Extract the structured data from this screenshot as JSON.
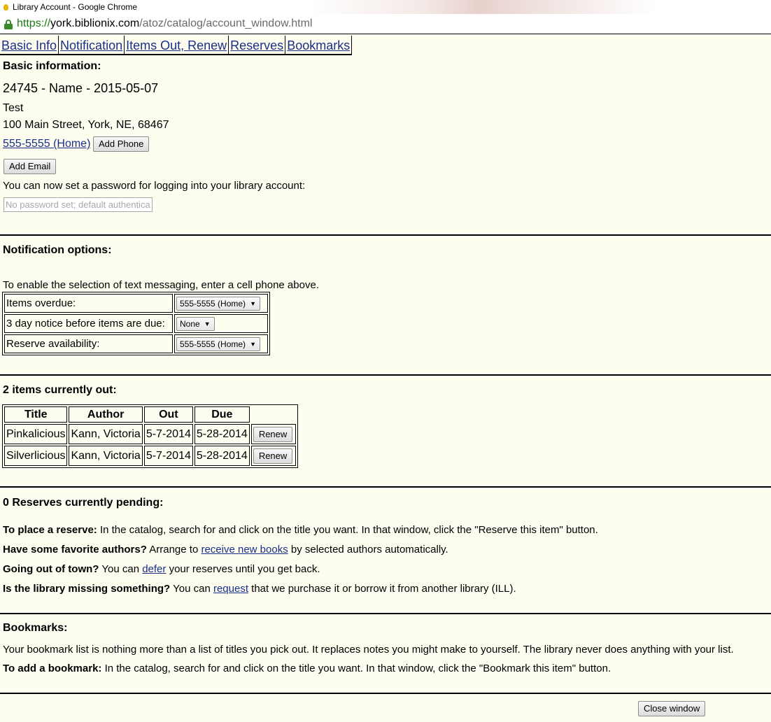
{
  "window": {
    "title": "Library Account - Google Chrome"
  },
  "address_bar": {
    "scheme": "https://",
    "host": "york.biblionix.com",
    "path": "/atoz/catalog/account_window.html"
  },
  "tabs": [
    {
      "label": "Basic Info"
    },
    {
      "label": "Notification"
    },
    {
      "label": "Items Out, Renew"
    },
    {
      "label": "Reserves"
    },
    {
      "label": "Bookmarks"
    }
  ],
  "basic": {
    "heading": "Basic information:",
    "account_line": "24745 - Name - 2015-05-07",
    "name": "Test",
    "address": "100 Main Street, York, NE, 68467",
    "phone_link": "555-5555 (Home)",
    "add_phone_label": "Add Phone",
    "add_email_label": "Add Email",
    "password_prompt": "You can now set a password for logging into your library account:",
    "password_placeholder": "No password set; default authentication"
  },
  "notification": {
    "heading": "Notification options:",
    "hint": "To enable the selection of text messaging, enter a cell phone above.",
    "rows": [
      {
        "label": "Items overdue:",
        "value": "555-5555 (Home)"
      },
      {
        "label": "3 day notice before items are due:",
        "value": "None"
      },
      {
        "label": "Reserve availability:",
        "value": "555-5555 (Home)"
      }
    ]
  },
  "items_out": {
    "heading": "2 items currently out:",
    "columns": [
      "Title",
      "Author",
      "Out",
      "Due"
    ],
    "rows": [
      {
        "title": "Pinkalicious",
        "author": "Kann, Victoria",
        "out": "5-7-2014",
        "due": "5-28-2014",
        "action": "Renew"
      },
      {
        "title": "Silverlicious",
        "author": "Kann, Victoria",
        "out": "5-7-2014",
        "due": "5-28-2014",
        "action": "Renew"
      }
    ]
  },
  "reserves": {
    "heading": "0 Reserves currently pending:",
    "place_bold": "To place a reserve:",
    "place_text": " In the catalog, search for and click on the title you want. In that window, click the \"Reserve this item\" button.",
    "authors_bold": "Have some favorite authors?",
    "authors_pre": " Arrange to ",
    "authors_link": "receive new books",
    "authors_post": " by selected authors automatically.",
    "town_bold": "Going out of town?",
    "town_pre": " You can ",
    "town_link": "defer",
    "town_post": " your reserves until you get back.",
    "missing_bold": "Is the library missing something?",
    "missing_pre": " You can ",
    "missing_link": "request",
    "missing_post": " that we purchase it or borrow it from another library (ILL)."
  },
  "bookmarks": {
    "heading": "Bookmarks:",
    "description": "Your bookmark list is nothing more than a list of titles you pick out. It replaces notes you might make to yourself. The library never does anything with your list.",
    "add_bold": "To add a bookmark:",
    "add_text": " In the catalog, search for and click on the title you want. In that window, click the \"Bookmark this item\" button."
  },
  "footer": {
    "close_label": "Close window"
  }
}
